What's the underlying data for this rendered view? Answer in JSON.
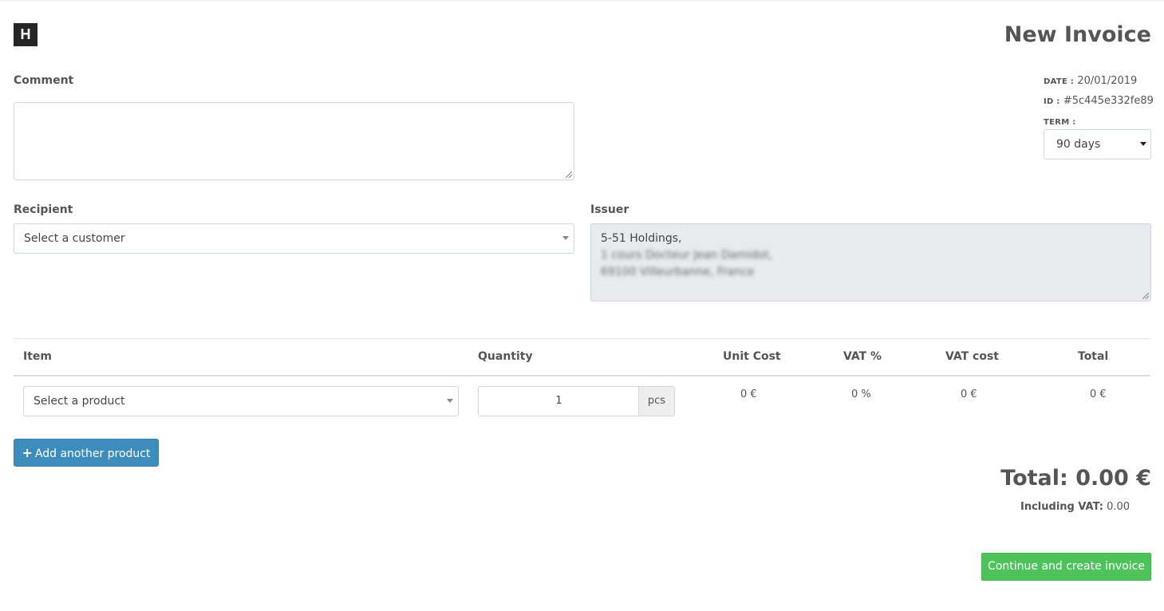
{
  "logo": {
    "letter": "H"
  },
  "page": {
    "title": "New Invoice"
  },
  "comment": {
    "label": "Comment",
    "value": ""
  },
  "meta": {
    "date_label": "DATE :",
    "date_value": "20/01/2019",
    "id_label": "ID :",
    "id_value": "#5c445e332fe89",
    "term_label": "TERM :",
    "term_value": "90 days"
  },
  "recipient": {
    "label": "Recipient",
    "placeholder": "Select a customer"
  },
  "issuer": {
    "label": "Issuer",
    "line1": "5-51 Holdings,",
    "line2": "1 cours Docteur Jean Damidot,",
    "line3": "69100 Villeurbanne, France"
  },
  "table": {
    "headers": [
      "Item",
      "Quantity",
      "Unit Cost",
      "VAT %",
      "VAT cost",
      "Total"
    ],
    "rows": [
      {
        "product": "Select a product",
        "quantity": "1",
        "unit": "pcs",
        "unit_cost": "0 €",
        "vat_percent": "0 %",
        "vat_cost": "0 €",
        "total": "0 €"
      }
    ]
  },
  "buttons": {
    "add_product_icon": "+",
    "add_product": "Add another product",
    "continue": "Continue and create invoice"
  },
  "summary": {
    "total": "Total: 0.00 €",
    "including_vat_label": "Including VAT:",
    "including_vat_value": "0.00"
  },
  "colors": {
    "primary": "#3c8dbc",
    "success": "#4ec25b",
    "text": "#555555",
    "readonly_bg": "#e8ebee"
  }
}
